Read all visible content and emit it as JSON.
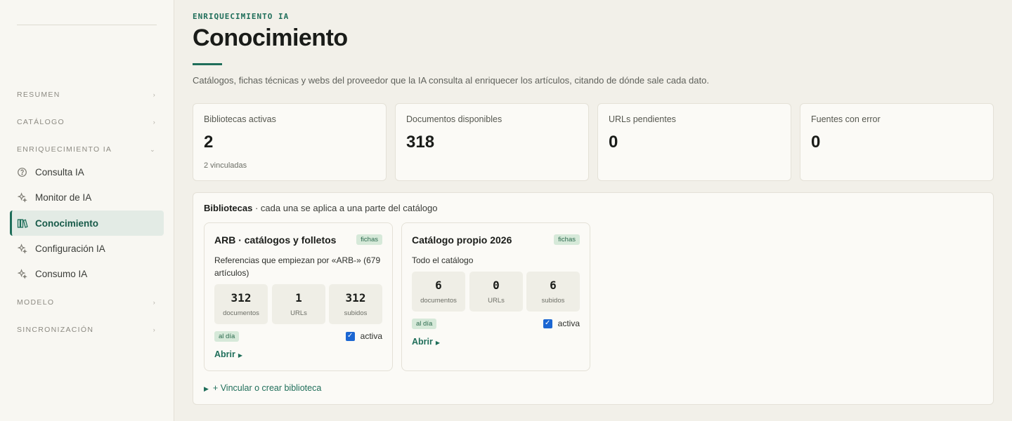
{
  "sidebar": {
    "sections": [
      {
        "label": "RESUMEN"
      },
      {
        "label": "CATÁLOGO"
      },
      {
        "label": "ENRIQUECIMIENTO IA"
      },
      {
        "label": "MODELO"
      },
      {
        "label": "SINCRONIZACIÓN"
      }
    ],
    "items": [
      {
        "label": "Consulta IA",
        "icon": "chat-question-icon"
      },
      {
        "label": "Monitor de IA",
        "icon": "sparkles-icon"
      },
      {
        "label": "Conocimiento",
        "icon": "library-icon",
        "active": true
      },
      {
        "label": "Configuración IA",
        "icon": "sparkles-icon"
      },
      {
        "label": "Consumo IA",
        "icon": "sparkles-icon"
      }
    ]
  },
  "header": {
    "eyebrow": "ENRIQUECIMIENTO IA",
    "title": "Conocimiento",
    "description": "Catálogos, fichas técnicas y webs del proveedor que la IA consulta al enriquecer los artículos, citando de dónde sale cada dato."
  },
  "stats": [
    {
      "label": "Bibliotecas activas",
      "value": "2",
      "sub": "2 vinculadas"
    },
    {
      "label": "Documentos disponibles",
      "value": "318",
      "sub": ""
    },
    {
      "label": "URLs pendientes",
      "value": "0",
      "sub": ""
    },
    {
      "label": "Fuentes con error",
      "value": "0",
      "sub": ""
    }
  ],
  "libraries": {
    "heading_bold": "Bibliotecas",
    "heading_rest": " · cada una se aplica a una parte del catálogo",
    "cards": [
      {
        "name": "ARB · catálogos y folletos",
        "badge": "fichas",
        "scope": "Referencias que empiezan por «ARB-» (679 artículos)",
        "metrics": [
          {
            "value": "312",
            "label": "documentos"
          },
          {
            "value": "1",
            "label": "URLs"
          },
          {
            "value": "312",
            "label": "subidos"
          }
        ],
        "status": "al día",
        "active_label": "activa",
        "active": true,
        "open_label": "Abrir"
      },
      {
        "name": "Catálogo propio 2026",
        "badge": "fichas",
        "scope": "Todo el catálogo",
        "metrics": [
          {
            "value": "6",
            "label": "documentos"
          },
          {
            "value": "0",
            "label": "URLs"
          },
          {
            "value": "6",
            "label": "subidos"
          }
        ],
        "status": "al día",
        "active_label": "activa",
        "active": true,
        "open_label": "Abrir"
      }
    ],
    "create_label": "+ Vincular o crear biblioteca"
  },
  "colors": {
    "accent": "#1f6e5a",
    "badge_bg": "#d6e9d9",
    "checkbox": "#1b66d2",
    "background": "#f2f0e9"
  }
}
